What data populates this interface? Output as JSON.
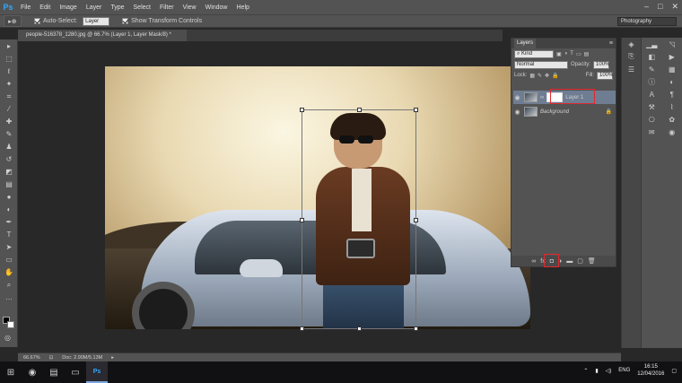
{
  "app": {
    "logo": "Ps"
  },
  "menu": [
    "File",
    "Edit",
    "Image",
    "Layer",
    "Type",
    "Select",
    "Filter",
    "View",
    "Window",
    "Help"
  ],
  "window_controls": [
    "–",
    "□",
    "✕"
  ],
  "options": {
    "tool_glyph": "▸⊕",
    "auto_select": "Auto-Select:",
    "auto_select_target": "Layer",
    "show_transform": "Show Transform Controls",
    "workspace": "Photography"
  },
  "document": {
    "tab_title": "people-516378_1280.jpg @ 66.7% (Layer 1, Layer Mask/8) *"
  },
  "layers_panel": {
    "title": "Layers",
    "kind_label": "Kind",
    "blend_mode": "Normal",
    "opacity_label": "Opacity:",
    "opacity_value": "100%",
    "lock_label": "Lock:",
    "fill_label": "Fill:",
    "fill_value": "100%",
    "layers": [
      {
        "name": "Layer 1",
        "selected": true
      },
      {
        "name": "Background",
        "selected": false
      }
    ]
  },
  "status": {
    "zoom": "66.67%",
    "doc": "Doc: 2.90M/5.13M"
  },
  "taskbar": {
    "language": "ENG",
    "time": "16:15",
    "date": "12/04/2016"
  },
  "colors": {
    "accent_red": "#e0282c",
    "selection": "#6f7d93",
    "ps_blue": "#31a8ff"
  }
}
